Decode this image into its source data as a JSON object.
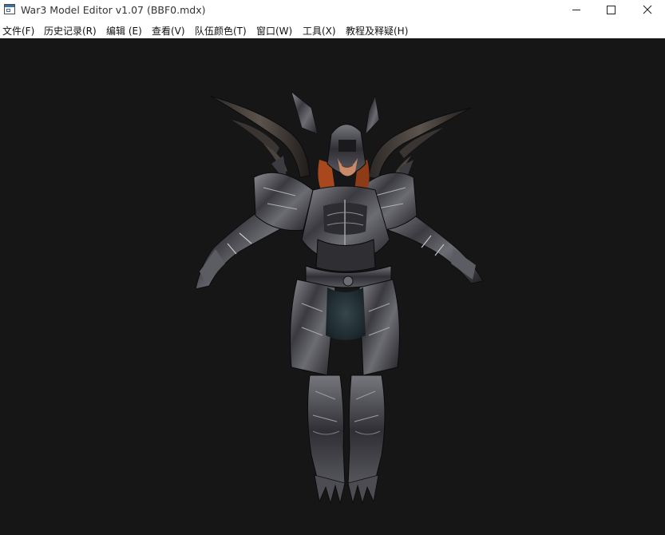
{
  "window": {
    "title": "War3 Model Editor v1.07 (BBF0.mdx)",
    "icon": "app-window-icon",
    "controls": [
      "minimize-icon",
      "maximize-icon",
      "close-icon"
    ]
  },
  "menu": {
    "items": [
      {
        "label": "文件(F)"
      },
      {
        "label": "历史记录(R)"
      },
      {
        "label": "编辑 (E)"
      },
      {
        "label": "查看(V)"
      },
      {
        "label": "队伍颜色(T)"
      },
      {
        "label": "窗口(W)"
      },
      {
        "label": "工具(X)"
      },
      {
        "label": "教程及释疑(H)"
      }
    ]
  },
  "viewport": {
    "background": "#161616",
    "content": "3D model render: armored horned demon warrior"
  },
  "colors": {
    "armor_dark": "#2a2a2e",
    "armor_mid": "#55555c",
    "armor_highlight": "#b8b8bc",
    "hair": "#a8481c",
    "skin": "#c98a6a",
    "cloth": "#263238"
  }
}
